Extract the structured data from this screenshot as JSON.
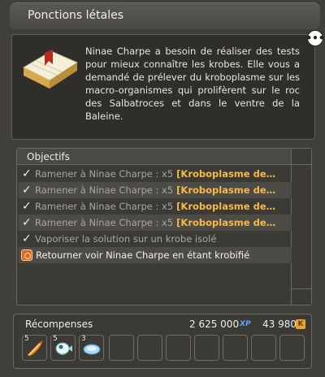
{
  "window": {
    "title": "Ponctions létales"
  },
  "quest": {
    "description": "Ninae Charpe a besoin de réaliser des tests pour mieux connaître les krobes. Elle vous a demandé de prélever du kroboplasme sur les macro-organismes qui prolifèrent sur le roc des Salbatroces et dans le ventre de la Baleine.",
    "icon": "open-book-icon"
  },
  "objectives": {
    "label": "Objectifs",
    "items": [
      {
        "text": "Ramener à Ninae Charpe : x5",
        "highlight": "[Kroboplasme de…",
        "status": "done"
      },
      {
        "text": "Ramener à Ninae Charpe : x5",
        "highlight": "[Kroboplasme de…",
        "status": "done"
      },
      {
        "text": "Ramener à Ninae Charpe : x5",
        "highlight": "[Kroboplasme de…",
        "status": "done"
      },
      {
        "text": "Ramener à Ninae Charpe : x5",
        "highlight": "[Kroboplasme de…",
        "status": "done"
      },
      {
        "text": "Vaporiser la solution sur un krobe isolé",
        "highlight": "",
        "status": "done"
      },
      {
        "text": "Retourner voir Ninae Charpe en étant krobifié",
        "highlight": "",
        "status": "active"
      }
    ]
  },
  "rewards": {
    "label": "Récompenses",
    "xp": "2 625 000",
    "xp_icon": "XP",
    "kamas": "43 980",
    "kamas_icon": "K",
    "items": [
      {
        "qty": "5",
        "icon": "orange-feather-icon"
      },
      {
        "qty": "5",
        "icon": "fish-creature-icon"
      },
      {
        "qty": "3",
        "icon": "blue-disc-icon"
      },
      {
        "qty": "",
        "icon": ""
      },
      {
        "qty": "",
        "icon": ""
      },
      {
        "qty": "",
        "icon": ""
      },
      {
        "qty": "",
        "icon": ""
      },
      {
        "qty": "",
        "icon": ""
      },
      {
        "qty": "",
        "icon": ""
      }
    ]
  },
  "colors": {
    "highlight": "#f6b94a",
    "xp": "#5fa6ff",
    "kamas": "#e8a62a"
  }
}
